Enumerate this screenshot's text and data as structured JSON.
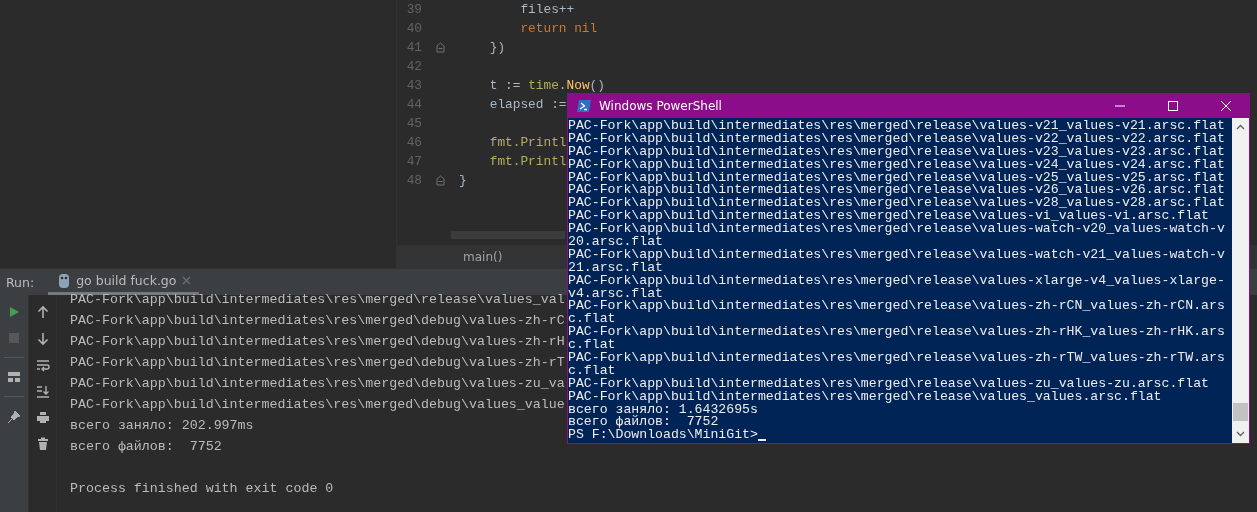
{
  "editor": {
    "lines": [
      {
        "number": "39",
        "fold": false,
        "tokens": [
          {
            "kind": "plain",
            "text": "        files++"
          }
        ]
      },
      {
        "number": "40",
        "fold": false,
        "tokens": [
          {
            "kind": "keyword",
            "text": "        return nil"
          }
        ]
      },
      {
        "number": "41",
        "fold": true,
        "tokens": [
          {
            "kind": "plain",
            "text": "    })"
          }
        ]
      },
      {
        "number": "42",
        "fold": false
      },
      {
        "number": "43",
        "fold": false,
        "tokens": [
          {
            "kind": "plain",
            "text": "    t := "
          },
          {
            "kind": "package",
            "text": "time"
          },
          {
            "kind": "plain",
            "text": "."
          },
          {
            "kind": "call",
            "text": "Now"
          },
          {
            "kind": "plain",
            "text": "()"
          }
        ]
      },
      {
        "number": "44",
        "fold": false,
        "tokens": [
          {
            "kind": "plain",
            "text": "    elapsed :="
          }
        ]
      },
      {
        "number": "45",
        "fold": false
      },
      {
        "number": "46",
        "fold": false,
        "tokens": [
          {
            "kind": "package",
            "text": "    fmt.Printl"
          }
        ]
      },
      {
        "number": "47",
        "fold": false,
        "tokens": [
          {
            "kind": "package",
            "text": "    fmt.Printl"
          }
        ]
      },
      {
        "number": "48",
        "fold": true,
        "tokens": [
          {
            "kind": "plain",
            "text": "}"
          }
        ]
      }
    ],
    "breadcrumb": "main()"
  },
  "run_panel": {
    "label": "Run:",
    "tab": {
      "title": "go build fuck.go",
      "selected": true
    },
    "output": [
      "PAC-Fork\\app\\build\\intermediates\\res\\merged\\release\\values_val",
      "PAC-Fork\\app\\build\\intermediates\\res\\merged\\debug\\values-zh-rC",
      "PAC-Fork\\app\\build\\intermediates\\res\\merged\\debug\\values-zh-rH",
      "PAC-Fork\\app\\build\\intermediates\\res\\merged\\debug\\values-zh-rT",
      "PAC-Fork\\app\\build\\intermediates\\res\\merged\\debug\\values-zu_va",
      "PAC-Fork\\app\\build\\intermediates\\res\\merged\\debug\\values_value",
      "всего заняло: 202.997ms",
      "всего файлов:  7752",
      "Process finished with exit code 0"
    ]
  },
  "powershell": {
    "title": "Windows PowerShell",
    "lines": [
      "PAC-Fork\\app\\build\\intermediates\\res\\merged\\release\\values-v21_values-v21.arsc.flat",
      "PAC-Fork\\app\\build\\intermediates\\res\\merged\\release\\values-v22_values-v22.arsc.flat",
      "PAC-Fork\\app\\build\\intermediates\\res\\merged\\release\\values-v23_values-v23.arsc.flat",
      "PAC-Fork\\app\\build\\intermediates\\res\\merged\\release\\values-v24_values-v24.arsc.flat",
      "PAC-Fork\\app\\build\\intermediates\\res\\merged\\release\\values-v25_values-v25.arsc.flat",
      "PAC-Fork\\app\\build\\intermediates\\res\\merged\\release\\values-v26_values-v26.arsc.flat",
      "PAC-Fork\\app\\build\\intermediates\\res\\merged\\release\\values-v28_values-v28.arsc.flat",
      "PAC-Fork\\app\\build\\intermediates\\res\\merged\\release\\values-vi_values-vi.arsc.flat",
      "PAC-Fork\\app\\build\\intermediates\\res\\merged\\release\\values-watch-v20_values-watch-v",
      "20.arsc.flat",
      "PAC-Fork\\app\\build\\intermediates\\res\\merged\\release\\values-watch-v21_values-watch-v",
      "21.arsc.flat",
      "PAC-Fork\\app\\build\\intermediates\\res\\merged\\release\\values-xlarge-v4_values-xlarge-",
      "v4.arsc.flat",
      "PAC-Fork\\app\\build\\intermediates\\res\\merged\\release\\values-zh-rCN_values-zh-rCN.ars",
      "c.flat",
      "PAC-Fork\\app\\build\\intermediates\\res\\merged\\release\\values-zh-rHK_values-zh-rHK.ars",
      "c.flat",
      "PAC-Fork\\app\\build\\intermediates\\res\\merged\\release\\values-zh-rTW_values-zh-rTW.ars",
      "c.flat",
      "PAC-Fork\\app\\build\\intermediates\\res\\merged\\release\\values-zu_values-zu.arsc.flat",
      "PAC-Fork\\app\\build\\intermediates\\res\\merged\\release\\values_values.arsc.flat",
      "всего заняло: 1.6432695s",
      "всего файлов:  7752"
    ],
    "prompt": "PS F:\\Downloads\\MiniGit>"
  }
}
